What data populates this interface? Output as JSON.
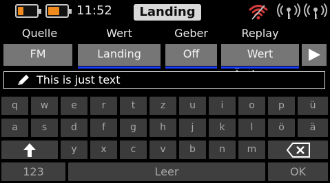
{
  "status": {
    "time": "11:52",
    "title": "Landing",
    "battery_1_level": 0.3,
    "battery_2_level": 0.6,
    "battery_color": "#f08a1c",
    "icons": [
      "battery-icon",
      "battery-icon",
      "wifi-icon",
      "antenna-icon",
      "antenna-icon"
    ]
  },
  "columns": {
    "source": "Quelle",
    "value": "Wert",
    "sender": "Geber",
    "replay": "Replay"
  },
  "values": {
    "source": "FM",
    "value": "Landing",
    "sender": "Off",
    "replay": "Wert Änderung",
    "play_icon": "play-icon"
  },
  "textfield": {
    "icon": "pencil-icon",
    "value": "This is just text"
  },
  "keyboard": {
    "row1": [
      "q",
      "w",
      "e",
      "r",
      "t",
      "z",
      "u",
      "i",
      "o",
      "p",
      "ü"
    ],
    "row2": [
      "a",
      "s",
      "d",
      "f",
      "g",
      "h",
      "j",
      "k",
      "l",
      "ö",
      "ä"
    ],
    "row3": [
      "y",
      "x",
      "c",
      "v",
      "b",
      "n",
      "m"
    ],
    "shift_symbol": "🡑",
    "backspace_symbol": "X",
    "numbers_label": "123",
    "space_label": "Leer",
    "ok_label": "OK"
  },
  "colors": {
    "accent_blue": "#1a3dff",
    "button_gray": "#767676",
    "key_gray": "#3b3b3b"
  }
}
